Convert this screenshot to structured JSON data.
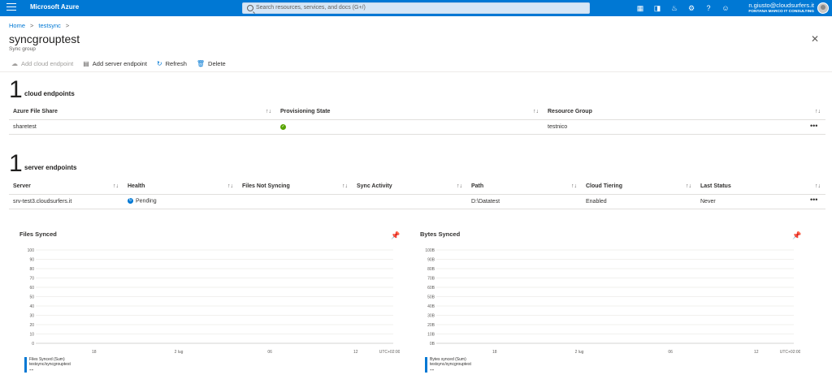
{
  "topbar": {
    "brand": "Microsoft Azure",
    "search_placeholder": "Search resources, services, and docs (G+/)",
    "user_email": "n.giusto@cloudsurfers.it",
    "user_org": "FONTANA MARCO IT CONSULTING",
    "icons": [
      "cloud-shell-icon",
      "directory-filter-icon",
      "bell-icon",
      "gear-icon",
      "help-icon",
      "feedback-icon"
    ]
  },
  "breadcrumb": {
    "home": "Home",
    "sep": ">",
    "parent": "testsync"
  },
  "page": {
    "title": "syncgrouptest",
    "subtitle": "Sync group"
  },
  "toolbar": {
    "add_cloud": "Add cloud endpoint",
    "add_server": "Add server endpoint",
    "refresh": "Refresh",
    "delete": "Delete"
  },
  "cloud": {
    "count": "1",
    "label": "cloud endpoints",
    "headers": [
      "Azure File Share",
      "Provisioning State",
      "Resource Group"
    ],
    "rows": [
      {
        "share": "sharetest",
        "state": "ok",
        "group": "testnico"
      }
    ]
  },
  "server": {
    "count": "1",
    "label": "server endpoints",
    "headers": [
      "Server",
      "Health",
      "Files Not Syncing",
      "Sync Activity",
      "Path",
      "Cloud Tiering",
      "Last Status"
    ],
    "rows": [
      {
        "server": "srv-test3.cloudsurfers.it",
        "health": "Pending",
        "files": "",
        "activity": "",
        "path": "D:\\Datatest",
        "tiering": "Enabled",
        "status": "Never"
      }
    ]
  },
  "sort_glyph": "↑↓",
  "more_glyph": "•••",
  "charts": {
    "files": {
      "title": "Files Synced",
      "legend_name": "Files Synced (Sum)",
      "legend_sub": "testsync/syncgrouptest",
      "legend_value": "--"
    },
    "bytes": {
      "title": "Bytes Synced",
      "legend_name": "Bytes synced (Sum)",
      "legend_sub": "testsync/syncgrouptest",
      "legend_value": "--"
    }
  },
  "chart_data": [
    {
      "type": "line",
      "title": "Files Synced",
      "yticks": [
        "100",
        "90",
        "80",
        "70",
        "60",
        "50",
        "40",
        "30",
        "20",
        "10",
        "0"
      ],
      "ylim": [
        0,
        100
      ],
      "xticks": [
        "18",
        "2 lug",
        "06",
        "12",
        "UTC+02:00"
      ],
      "series": []
    },
    {
      "type": "line",
      "title": "Bytes Synced",
      "yticks": [
        "100B",
        "90B",
        "80B",
        "70B",
        "60B",
        "50B",
        "40B",
        "30B",
        "20B",
        "10B",
        "0B"
      ],
      "ylim": [
        0,
        100
      ],
      "xticks": [
        "18",
        "2 lug",
        "06",
        "12",
        "UTC+02:00"
      ],
      "series": []
    }
  ]
}
